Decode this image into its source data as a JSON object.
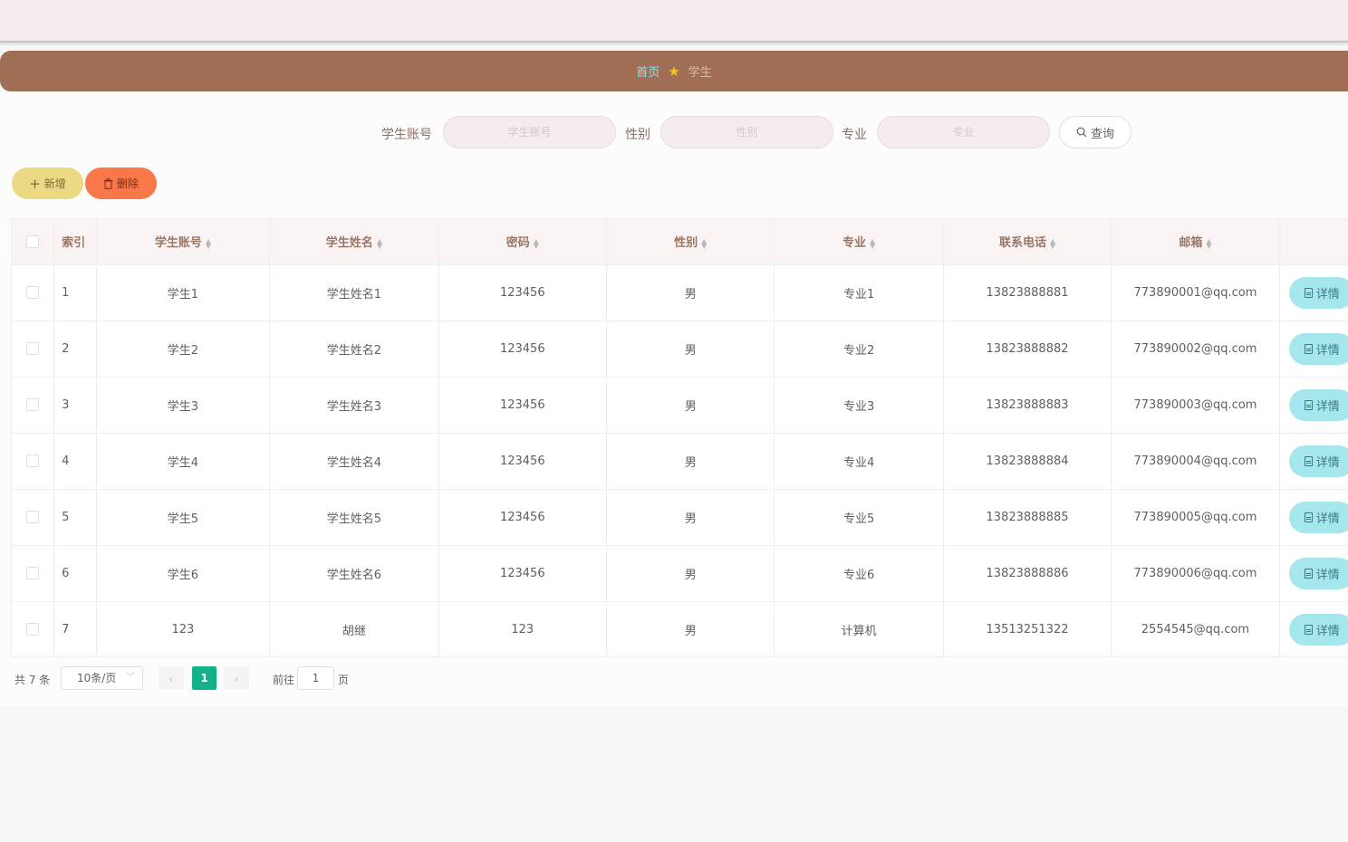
{
  "breadcrumb": {
    "home": "首页",
    "separator_icon": "star-icon",
    "current": "学生"
  },
  "search": {
    "fields": [
      {
        "label": "学生账号",
        "placeholder": "学生账号"
      },
      {
        "label": "性别",
        "placeholder": "性别"
      },
      {
        "label": "专业",
        "placeholder": "专业"
      }
    ],
    "button_label": "查询",
    "button_icon": "search-icon"
  },
  "actions": {
    "add_label": "新增",
    "add_icon": "plus-icon",
    "delete_label": "删除",
    "delete_icon": "trash-icon"
  },
  "table": {
    "columns": [
      "索引",
      "学生账号",
      "学生姓名",
      "密码",
      "性别",
      "专业",
      "联系电话",
      "邮箱"
    ],
    "rows": [
      {
        "index": "1",
        "account": "学生1",
        "name": "学生姓名1",
        "password": "123456",
        "gender": "男",
        "major": "专业1",
        "phone": "13823888881",
        "email": "773890001@qq.com"
      },
      {
        "index": "2",
        "account": "学生2",
        "name": "学生姓名2",
        "password": "123456",
        "gender": "男",
        "major": "专业2",
        "phone": "13823888882",
        "email": "773890002@qq.com"
      },
      {
        "index": "3",
        "account": "学生3",
        "name": "学生姓名3",
        "password": "123456",
        "gender": "男",
        "major": "专业3",
        "phone": "13823888883",
        "email": "773890003@qq.com"
      },
      {
        "index": "4",
        "account": "学生4",
        "name": "学生姓名4",
        "password": "123456",
        "gender": "男",
        "major": "专业4",
        "phone": "13823888884",
        "email": "773890004@qq.com"
      },
      {
        "index": "5",
        "account": "学生5",
        "name": "学生姓名5",
        "password": "123456",
        "gender": "男",
        "major": "专业5",
        "phone": "13823888885",
        "email": "773890005@qq.com"
      },
      {
        "index": "6",
        "account": "学生6",
        "name": "学生姓名6",
        "password": "123456",
        "gender": "男",
        "major": "专业6",
        "phone": "13823888886",
        "email": "773890006@qq.com"
      },
      {
        "index": "7",
        "account": "123",
        "name": "胡继",
        "password": "123",
        "gender": "男",
        "major": "计算机",
        "phone": "13513251322",
        "email": "2554545@qq.com"
      }
    ],
    "detail_label": "详情",
    "detail_icon": "document-icon"
  },
  "pagination": {
    "total_text": "共 7 条",
    "page_size": "10条/页",
    "current_page": "1",
    "goto_label": "前往",
    "goto_value": "1",
    "page_suffix": "页"
  },
  "colors": {
    "breadcrumb_bg": "#a06e55",
    "add_button": "#ecd984",
    "delete_button": "#f8784a",
    "detail_button": "#a6e7ee",
    "active_page": "#13b08c"
  }
}
